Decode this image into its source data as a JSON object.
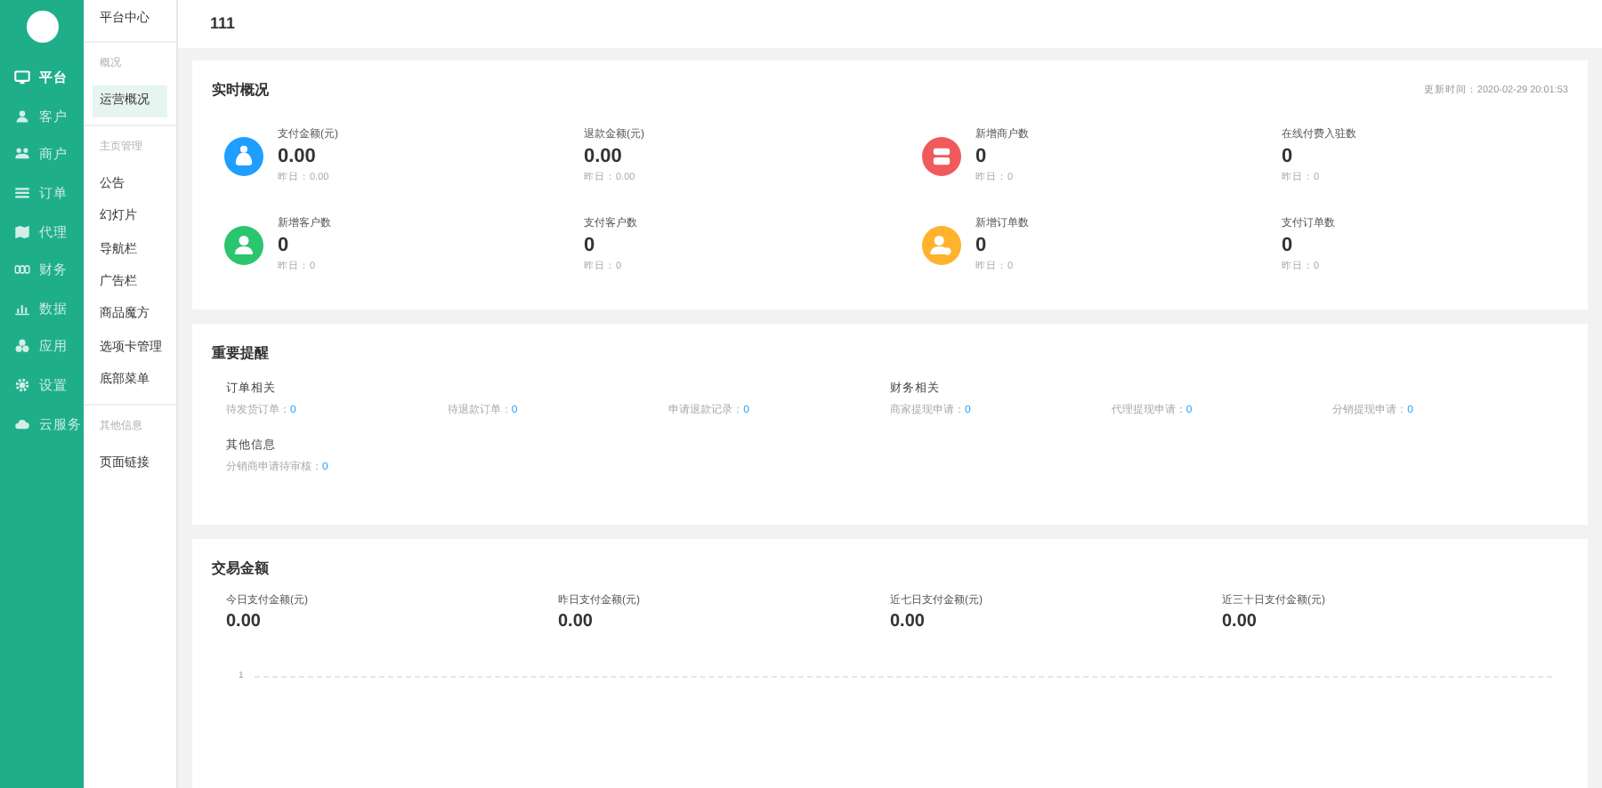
{
  "rail": {
    "items": [
      {
        "label": "平台",
        "selected": true
      },
      {
        "label": "客户",
        "selected": false
      },
      {
        "label": "商户",
        "selected": false
      },
      {
        "label": "订单",
        "selected": false
      },
      {
        "label": "代理",
        "selected": false
      },
      {
        "label": "财务",
        "selected": false
      },
      {
        "label": "数据",
        "selected": false
      },
      {
        "label": "应用",
        "selected": false
      },
      {
        "label": "设置",
        "selected": false
      },
      {
        "label": "云服务",
        "selected": false
      }
    ]
  },
  "submenu": {
    "title": "平台中心",
    "groups": [
      {
        "heading": "概况",
        "items": [
          {
            "label": "运营概况",
            "selected": true
          }
        ]
      },
      {
        "heading": "主页管理",
        "items": [
          {
            "label": "公告",
            "selected": false
          },
          {
            "label": "幻灯片",
            "selected": false
          },
          {
            "label": "导航栏",
            "selected": false
          },
          {
            "label": "广告栏",
            "selected": false
          },
          {
            "label": "商品魔方",
            "selected": false
          },
          {
            "label": "选项卡管理",
            "selected": false
          },
          {
            "label": "底部菜单",
            "selected": false
          }
        ]
      },
      {
        "heading": "其他信息",
        "items": [
          {
            "label": "页面链接",
            "selected": false
          }
        ]
      }
    ]
  },
  "topbar": {
    "title": "111"
  },
  "overview": {
    "title": "实时概况",
    "updated": "更新时间：2020-02-29 20:01:53",
    "stats": [
      {
        "label": "支付金额(元)",
        "value": "0.00",
        "yesterday": "昨日：0.00",
        "color": "#1e9fff"
      },
      {
        "label": "退款金额(元)",
        "value": "0.00",
        "yesterday": "昨日：0.00"
      },
      {
        "label": "新增商户数",
        "value": "0",
        "yesterday": "昨日：0",
        "color": "#f05a5a"
      },
      {
        "label": "在线付费入驻数",
        "value": "0",
        "yesterday": "昨日：0"
      },
      {
        "label": "新增客户数",
        "value": "0",
        "yesterday": "昨日：0",
        "color": "#2bc46f"
      },
      {
        "label": "支付客户数",
        "value": "0",
        "yesterday": "昨日：0"
      },
      {
        "label": "新增订单数",
        "value": "0",
        "yesterday": "昨日：0",
        "color": "#ffb22b"
      },
      {
        "label": "支付订单数",
        "value": "0",
        "yesterday": "昨日：0"
      }
    ]
  },
  "reminders": {
    "title": "重要提醒",
    "groups": [
      {
        "heading": "订单相关",
        "items": [
          {
            "label": "待发货订单：",
            "count": "0"
          },
          {
            "label": "待退款订单：",
            "count": "0"
          },
          {
            "label": "申请退款记录：",
            "count": "0"
          }
        ]
      },
      {
        "heading": "财务相关",
        "items": [
          {
            "label": "商家提现申请：",
            "count": "0"
          },
          {
            "label": "代理提现申请：",
            "count": "0"
          },
          {
            "label": "分销提现申请：",
            "count": "0"
          }
        ]
      },
      {
        "heading": "其他信息",
        "items": [
          {
            "label": "分销商申请待审核：",
            "count": "0"
          }
        ]
      }
    ]
  },
  "transactions": {
    "title": "交易金额",
    "stats": [
      {
        "label": "今日支付金额(元)",
        "value": "0.00"
      },
      {
        "label": "昨日支付金额(元)",
        "value": "0.00"
      },
      {
        "label": "近七日支付金额(元)",
        "value": "0.00"
      },
      {
        "label": "近三十日支付金额(元)",
        "value": "0.00"
      }
    ],
    "axis_label": "1"
  }
}
